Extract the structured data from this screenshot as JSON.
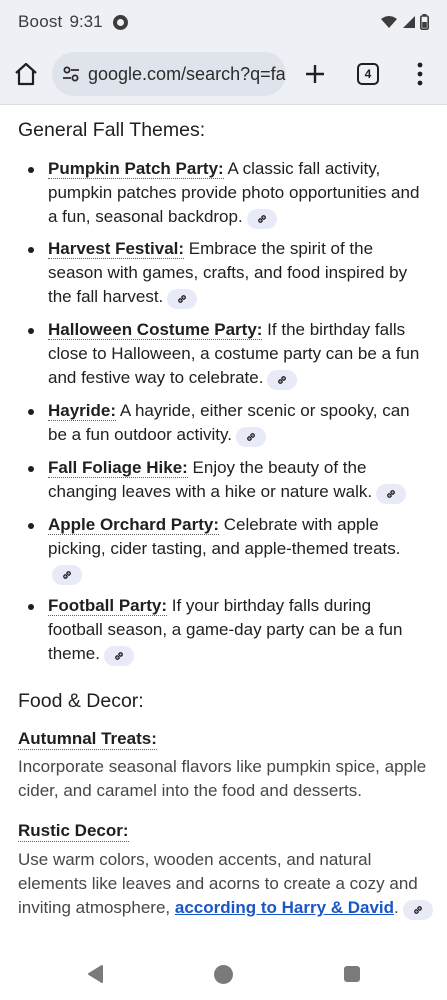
{
  "status_bar": {
    "carrier": "Boost",
    "time": "9:31",
    "icons": [
      "notification-badge-icon",
      "wifi-icon",
      "signal-icon",
      "battery-icon"
    ]
  },
  "toolbar": {
    "url": "google.com/search?q=fa",
    "tab_count": "4",
    "icons": [
      "home-icon",
      "site-settings-icon",
      "new-tab-plus-icon",
      "tab-switcher-icon",
      "more-menu-icon"
    ]
  },
  "content": {
    "section1_title": "General Fall Themes:",
    "themes": [
      {
        "term": "Pumpkin Patch Party:",
        "text": " A classic fall activity, pumpkin patches provide photo opportunities and a fun, seasonal backdrop."
      },
      {
        "term": "Harvest Festival:",
        "text": " Embrace the spirit of the season with games, crafts, and food inspired by the fall harvest."
      },
      {
        "term": "Halloween Costume Party:",
        "text": " If the birthday falls close to Halloween, a costume party can be a fun and festive way to celebrate."
      },
      {
        "term": "Hayride:",
        "text": " A hayride, either scenic or spooky, can be a fun outdoor activity."
      },
      {
        "term": "Fall Foliage Hike:",
        "text": " Enjoy the beauty of the changing leaves with a hike or nature walk."
      },
      {
        "term": "Apple Orchard Party:",
        "text": " Celebrate with apple picking, cider tasting, and apple-themed treats."
      },
      {
        "term": "Football Party:",
        "text": " If your birthday falls during football season, a game-day party can be a fun theme."
      }
    ],
    "section2_title": "Food & Decor:",
    "food_items": [
      {
        "term": "Autumnal Treats:",
        "text": "Incorporate seasonal flavors like pumpkin spice, apple cider, and caramel into the food and desserts."
      },
      {
        "term": "Rustic Decor:",
        "text": "Use warm colors, wooden accents, and natural elements like leaves and acorns to create a cozy and inviting atmosphere, ",
        "link": "according to Harry & David",
        "after_link": "."
      }
    ]
  },
  "colors": {
    "chrome_bg": "#eef0f6",
    "url_pill": "#dfe3eb",
    "link": "#1a56c8",
    "chip": "#e8eaf7",
    "body_text": "#1f1f1f",
    "secondary_text": "#474747"
  }
}
